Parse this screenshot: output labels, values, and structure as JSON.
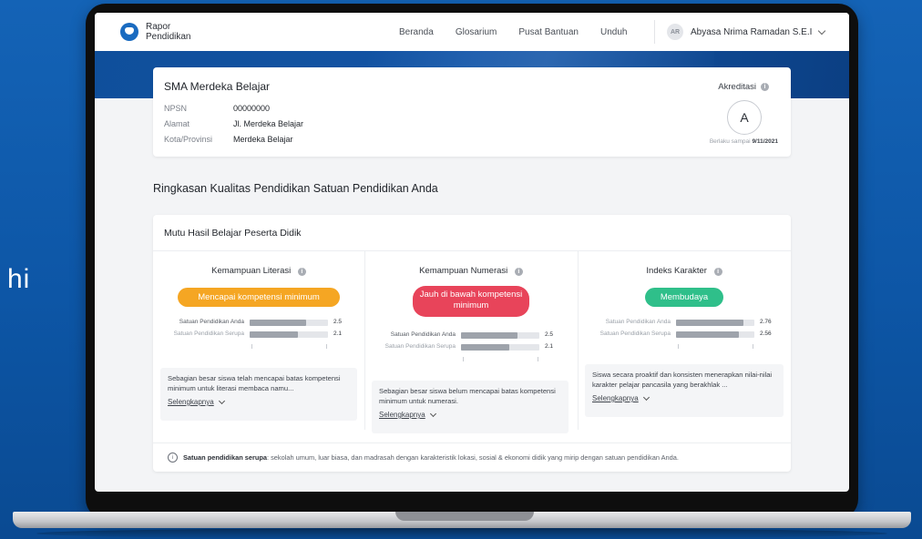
{
  "side_text": "hi",
  "nav": {
    "logo_line1": "Rapor",
    "logo_line2": "Pendidikan",
    "links": [
      "Beranda",
      "Glosarium",
      "Pusat Bantuan",
      "Unduh"
    ],
    "user_initials": "AR",
    "user_name": "Abyasa Nrima Ramadan S.E.I"
  },
  "school": {
    "name": "SMA Merdeka Belajar",
    "fields": [
      {
        "label": "NPSN",
        "value": "00000000"
      },
      {
        "label": "Alamat",
        "value": "Jl. Merdeka Belajar"
      },
      {
        "label": "Kota/Provinsi",
        "value": "Merdeka Belajar"
      }
    ],
    "accreditation_label": "Akreditasi",
    "accreditation_grade": "A",
    "valid_prefix": "Berlaku sampai",
    "valid_until": "9/11/2021"
  },
  "section_title": "Ringkasan Kualitas Pendidikan Satuan Pendidikan Anda",
  "quality": {
    "title": "Mutu Hasil Belajar Peserta Didik",
    "columns": [
      {
        "title": "Kemampuan Literasi",
        "badge": "Mencapai kompetensi minimum",
        "badge_color": "#f5a623",
        "rows": [
          {
            "label": "Satuan Pendidikan Anda",
            "value": "2.5",
            "fill": 0.72
          },
          {
            "label": "Satuan Pendidikan Serupa",
            "value": "2.1",
            "fill": 0.62
          }
        ],
        "description": "Sebagian besar siswa telah mencapai batas kompetensi minimum untuk literasi membaca namu...",
        "more": "Selengkapnya"
      },
      {
        "title": "Kemampuan Numerasi",
        "badge": "Jauh di bawah kompetensi minimum",
        "badge_color": "#e8445a",
        "rows": [
          {
            "label": "Satuan Pendidikan Anda",
            "value": "2.5",
            "fill": 0.72
          },
          {
            "label": "Satuan Pendidikan Serupa",
            "value": "2.1",
            "fill": 0.62
          }
        ],
        "description": "Sebagian besar siswa belum mencapai batas kompetensi minimum untuk numerasi.",
        "more": "Selengkapnya"
      },
      {
        "title": "Indeks Karakter",
        "badge": "Membudaya",
        "badge_color": "#2fbf8a",
        "rows": [
          {
            "label": "Satuan Pendidikan Anda",
            "value": "2.76",
            "fill": 0.86
          },
          {
            "label": "Satuan Pendidikan Serupa",
            "value": "2.56",
            "fill": 0.8
          }
        ],
        "description": "Siswa secara proaktif dan konsisten menerapkan nilai-nilai karakter pelajar pancasila yang berakhlak ...",
        "more": "Selengkapnya"
      }
    ],
    "note_bold": "Satuan pendidikan serupa",
    "note_text": ": sekolah umum, luar biasa, dan madrasah dengan karakteristik lokasi, sosial & ekonomi didik yang mirip dengan satuan pendidikan Anda."
  }
}
